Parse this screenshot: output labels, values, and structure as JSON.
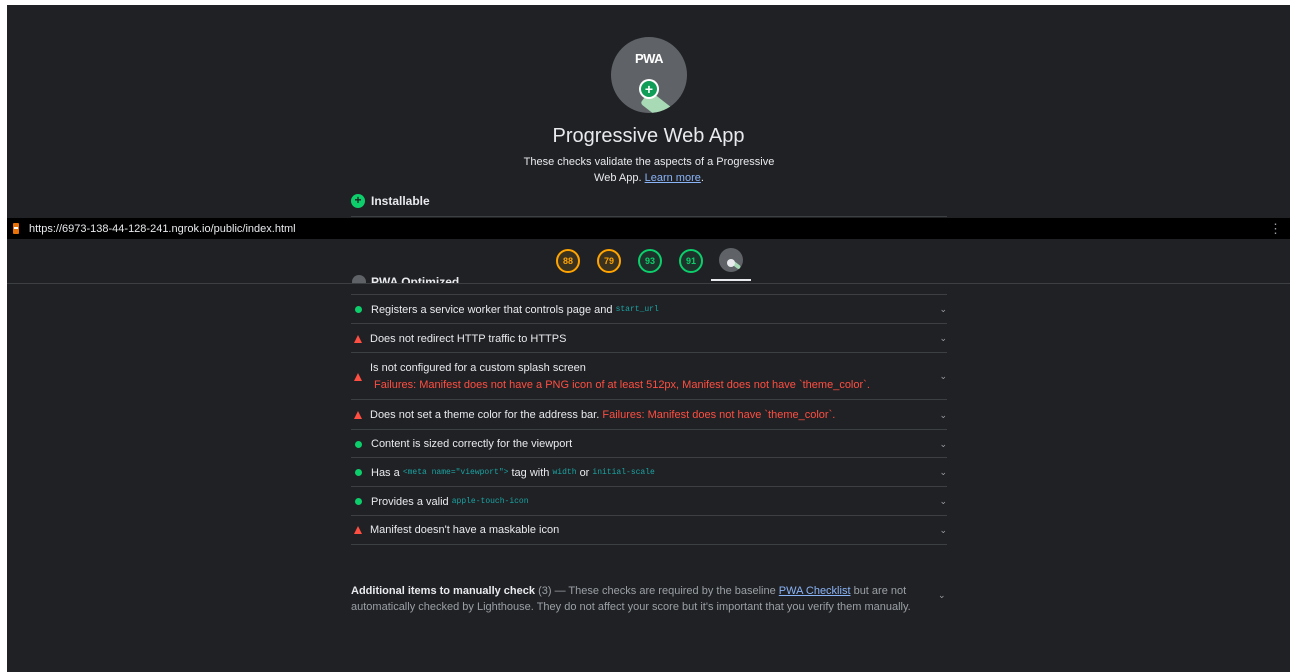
{
  "category": {
    "logo_text": "PWA",
    "title": "Progressive Web App",
    "description": "These checks validate the aspects of a Progressive Web App.",
    "learn_more": "Learn more",
    "group_installable": "Installable",
    "group_optimized": "PWA Optimized"
  },
  "urlbar": {
    "url": "https://6973-138-44-128-241.ngrok.io/public/index.html",
    "menu": "⋮"
  },
  "gauges": [
    {
      "score": "88",
      "level": "average"
    },
    {
      "score": "79",
      "level": "average"
    },
    {
      "score": "93",
      "level": "pass"
    },
    {
      "score": "91",
      "level": "pass"
    }
  ],
  "audits": {
    "a1": {
      "text": "Registers a service worker that controls page and",
      "code": "start_url",
      "status": "pass"
    },
    "a2": {
      "text": "Does not redirect HTTP traffic to HTTPS",
      "status": "fail"
    },
    "a3": {
      "text": "Is not configured for a custom splash screen",
      "detail": "Failures: Manifest does not have a PNG icon of at least 512px, Manifest does not have `theme_color`.",
      "status": "fail"
    },
    "a4": {
      "text": "Does not set a theme color for the address bar.",
      "detail": "Failures: Manifest does not have `theme_color`.",
      "status": "fail"
    },
    "a5": {
      "text": "Content is sized correctly for the viewport",
      "status": "pass"
    },
    "a6": {
      "pre": "Has a",
      "code1": "<meta name=\"viewport\">",
      "mid": "tag with",
      "code2": "width",
      "or": "or",
      "code3": "initial-scale",
      "status": "pass"
    },
    "a7": {
      "text": "Provides a valid",
      "code": "apple-touch-icon",
      "status": "pass"
    },
    "a8": {
      "text": "Manifest doesn't have a maskable icon",
      "status": "fail"
    }
  },
  "manual": {
    "title": "Additional items to manually check",
    "count": "(3)",
    "text1": " — These checks are required by the baseline ",
    "link": "PWA Checklist",
    "text2": " but are not automatically checked by Lighthouse. They do not affect your score but it's important that you verify them manually."
  },
  "colors": {
    "background": "#202124",
    "pass": "#0cce6b",
    "average": "#ffa400",
    "fail": "#ff4e42",
    "link": "#8ab4f8"
  }
}
